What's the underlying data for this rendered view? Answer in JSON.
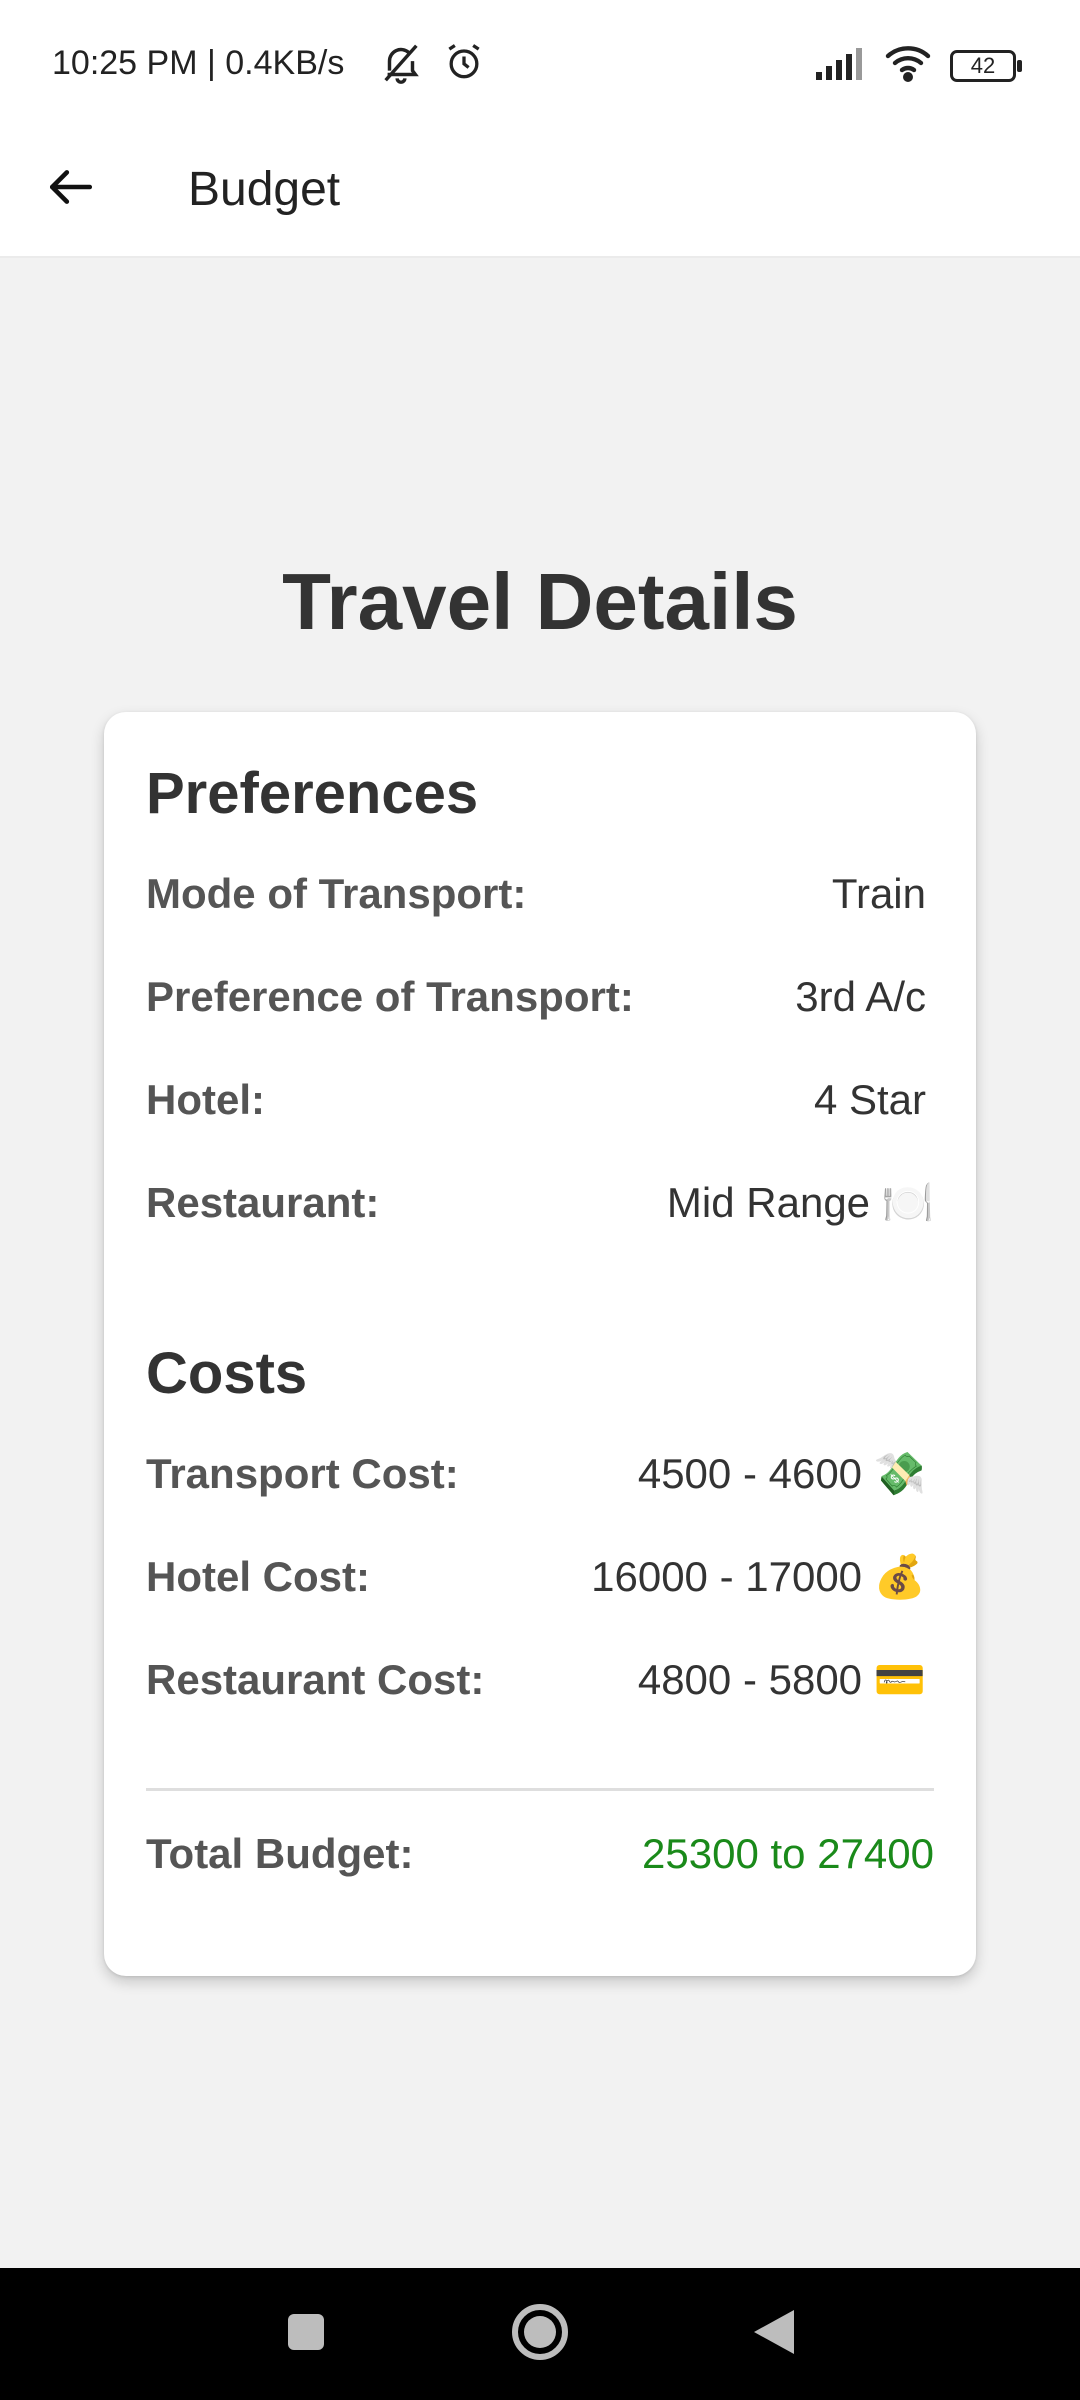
{
  "status_bar": {
    "time_and_speed": "10:25 PM | 0.4KB/s",
    "battery_level": "42",
    "icons": [
      "mute-bell-icon",
      "alarm-icon",
      "signal-icon",
      "wifi-icon",
      "battery-icon"
    ]
  },
  "app_bar": {
    "title": "Budget",
    "back_icon": "arrow-left-icon"
  },
  "page": {
    "heading": "Travel Details"
  },
  "preferences": {
    "title": "Preferences",
    "rows": [
      {
        "label": "Mode of Transport:",
        "value": "Train"
      },
      {
        "label": "Preference of Transport:",
        "value": "3rd A/c"
      },
      {
        "label": "Hotel:",
        "value": "4 Star"
      },
      {
        "label": "Restaurant:",
        "value": "Mid Range 🍽️"
      }
    ]
  },
  "costs": {
    "title": "Costs",
    "rows": [
      {
        "label": "Transport Cost:",
        "value": "4500 - 4600 💸"
      },
      {
        "label": "Hotel Cost:",
        "value": "16000 - 17000 💰"
      },
      {
        "label": "Restaurant Cost:",
        "value": "4800 - 5800 💳"
      }
    ]
  },
  "total": {
    "label": "Total Budget:",
    "value": "25300 to 27400",
    "color": "#1a8a1a"
  },
  "nav_bar": {
    "icons": [
      "recents-square-icon",
      "home-circle-icon",
      "back-triangle-icon"
    ]
  }
}
